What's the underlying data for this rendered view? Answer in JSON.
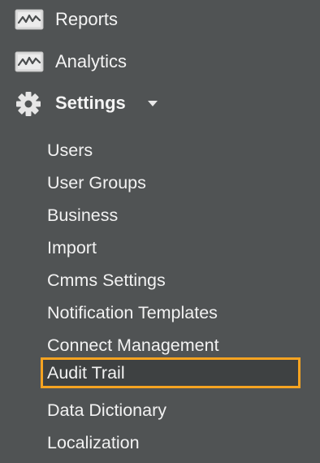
{
  "nav": {
    "reports_label": "Reports",
    "analytics_label": "Analytics",
    "settings_label": "Settings"
  },
  "settings_menu": {
    "items": [
      {
        "label": "Users"
      },
      {
        "label": "User Groups"
      },
      {
        "label": "Business"
      },
      {
        "label": "Import"
      },
      {
        "label": "Cmms Settings"
      },
      {
        "label": "Notification Templates"
      },
      {
        "label": "Connect Management"
      },
      {
        "label": "Audit Trail",
        "selected": true
      },
      {
        "label": "Data Dictionary"
      },
      {
        "label": "Localization"
      }
    ]
  },
  "colors": {
    "background": "#505354",
    "highlight_border": "#f5a321",
    "text": "#f4f4f4"
  },
  "icons": {
    "reports": "chart-icon",
    "analytics": "chart-icon",
    "settings": "gear-icon",
    "settings_caret": "caret-down-icon"
  }
}
